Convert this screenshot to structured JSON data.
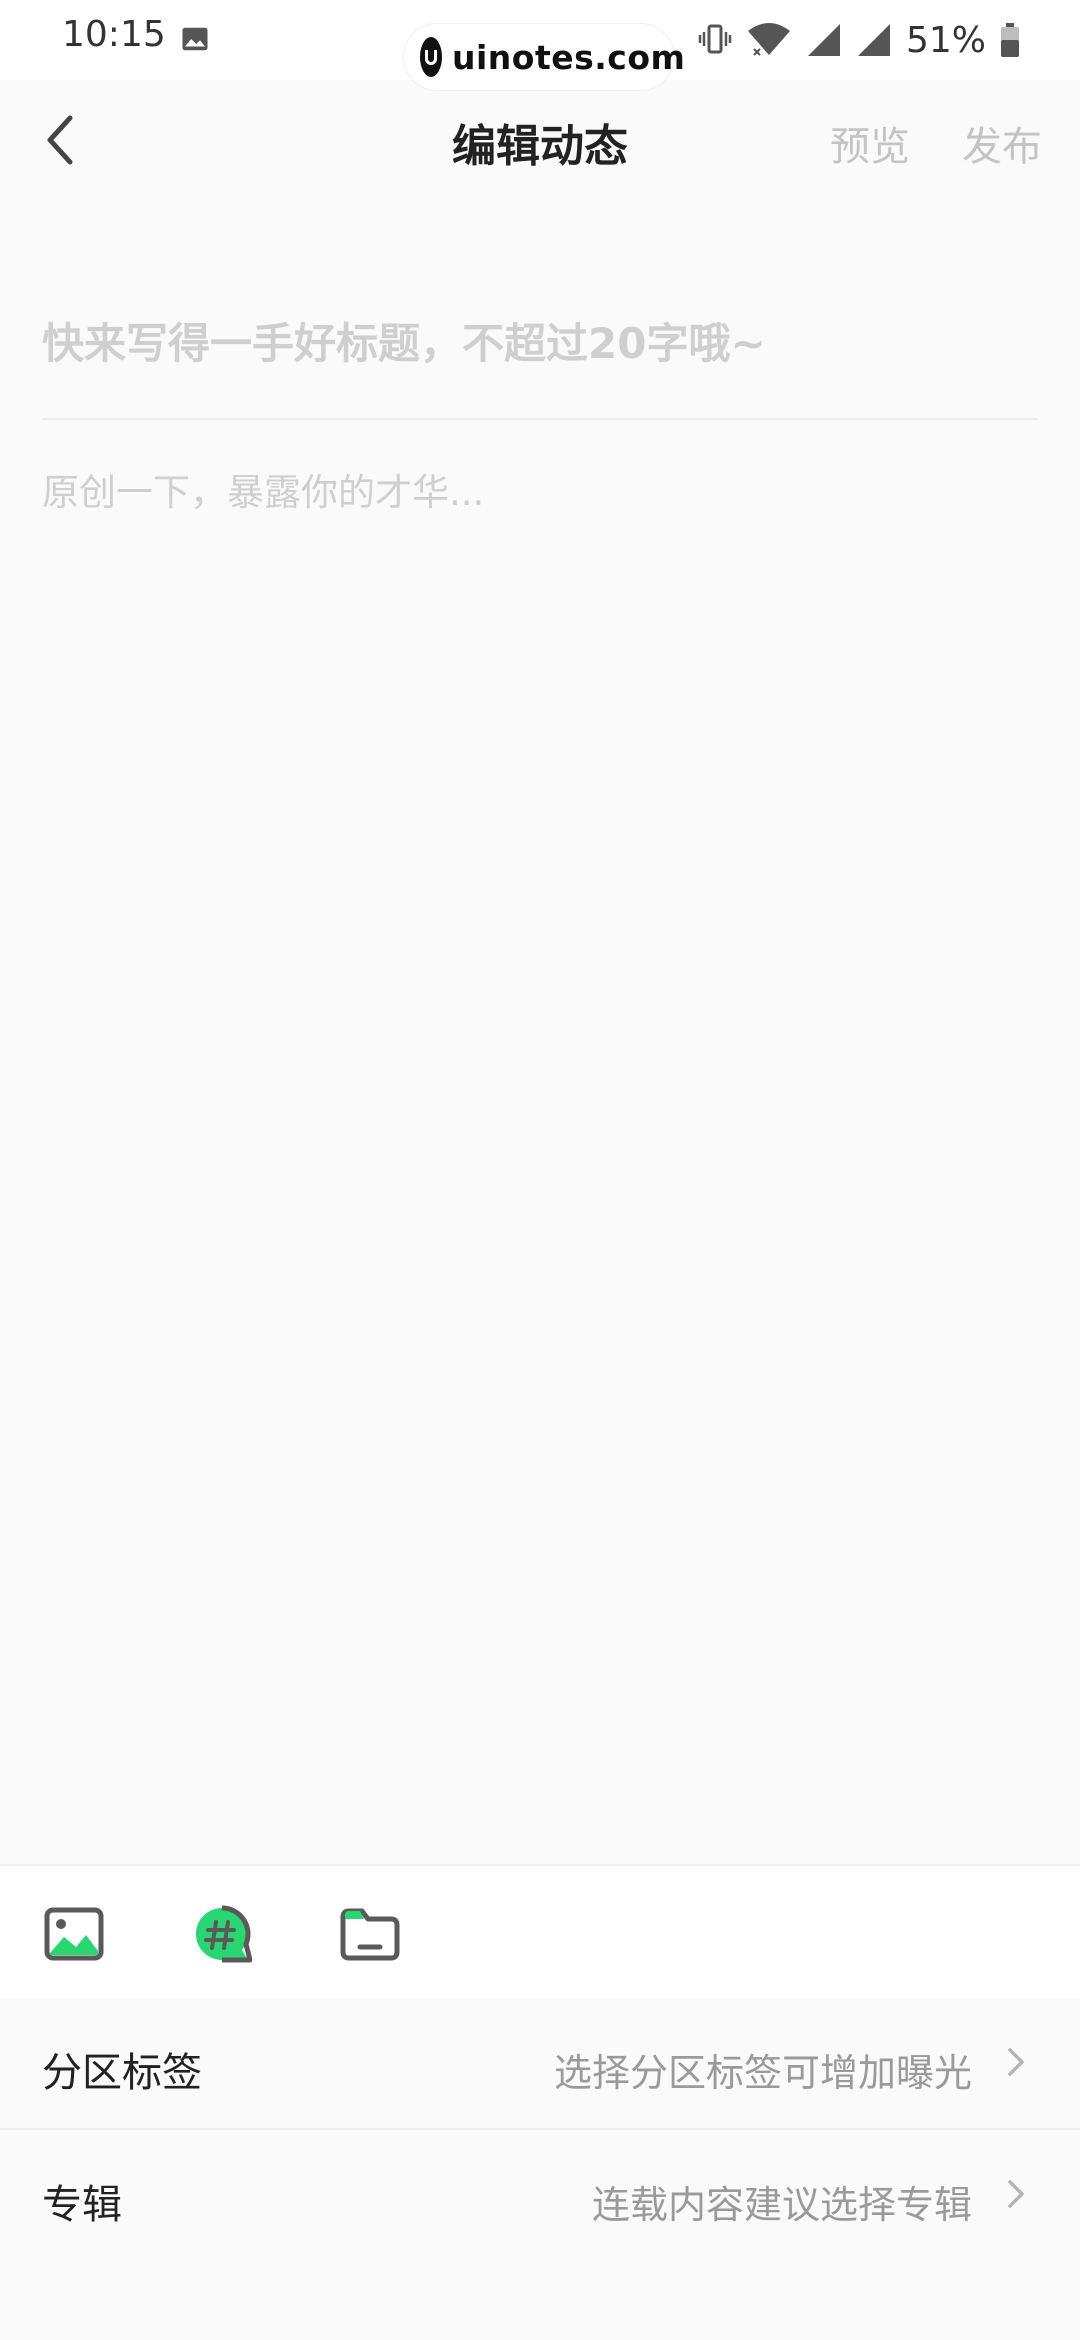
{
  "status_bar": {
    "time": "10:15",
    "battery_percent": "51%",
    "watermark": "uinotes.com",
    "icons": [
      "image-icon",
      "vibrate-icon",
      "wifi-icon",
      "signal-icon",
      "signal-icon",
      "battery-icon"
    ]
  },
  "header": {
    "title": "编辑动态",
    "preview_label": "预览",
    "publish_label": "发布"
  },
  "editor": {
    "title_placeholder": "快来写得一手好标题，不超过20字哦~",
    "body_placeholder": "原创一下，暴露你的才华..."
  },
  "toolbar": {
    "tools": [
      "image-icon",
      "topic-hashtag-icon",
      "folder-icon"
    ]
  },
  "rows": [
    {
      "label": "分区标签",
      "value": "选择分区标签可增加曝光"
    },
    {
      "label": "专辑",
      "value": "连载内容建议选择专辑"
    }
  ],
  "colors": {
    "accent": "#2ad672",
    "icon_stroke": "#5a5a5a",
    "placeholder": "#cfcfcf",
    "disabled_text": "#c4c4c4"
  }
}
